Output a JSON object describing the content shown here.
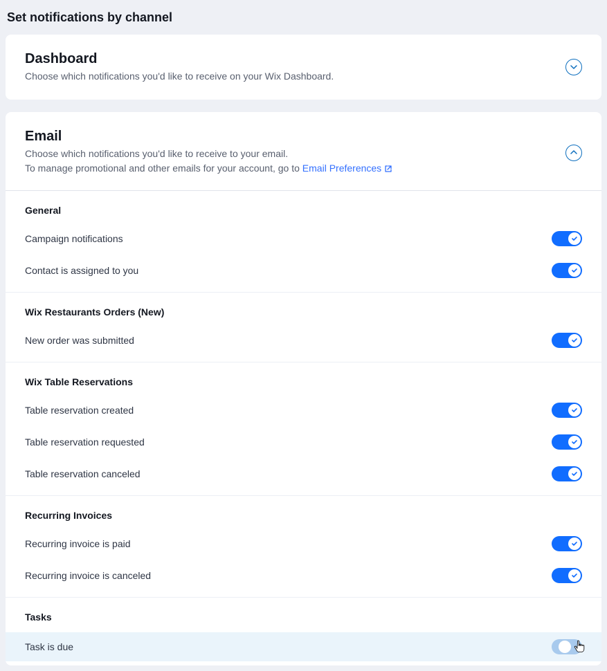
{
  "page": {
    "title": "Set notifications by channel"
  },
  "dashboard": {
    "title": "Dashboard",
    "desc": "Choose which notifications you'd like to receive on your Wix Dashboard."
  },
  "email": {
    "title": "Email",
    "desc_line1": "Choose which notifications you'd like to receive to your email.",
    "desc_line2_prefix": "To manage promotional and other emails for your account, go to ",
    "link_label": "Email Preferences"
  },
  "sections": {
    "general": {
      "title": "General",
      "items": [
        {
          "label": "Campaign notifications",
          "on": true
        },
        {
          "label": "Contact is assigned to you",
          "on": true
        }
      ]
    },
    "restaurants": {
      "title": "Wix Restaurants Orders (New)",
      "items": [
        {
          "label": "New order was submitted",
          "on": true
        }
      ]
    },
    "reservations": {
      "title": "Wix Table Reservations",
      "items": [
        {
          "label": "Table reservation created",
          "on": true
        },
        {
          "label": "Table reservation requested",
          "on": true
        },
        {
          "label": "Table reservation canceled",
          "on": true
        }
      ]
    },
    "invoices": {
      "title": "Recurring Invoices",
      "items": [
        {
          "label": "Recurring invoice is paid",
          "on": true
        },
        {
          "label": "Recurring invoice is canceled",
          "on": true
        }
      ]
    },
    "tasks": {
      "title": "Tasks",
      "items": [
        {
          "label": "Task is due",
          "on": false
        }
      ]
    }
  }
}
